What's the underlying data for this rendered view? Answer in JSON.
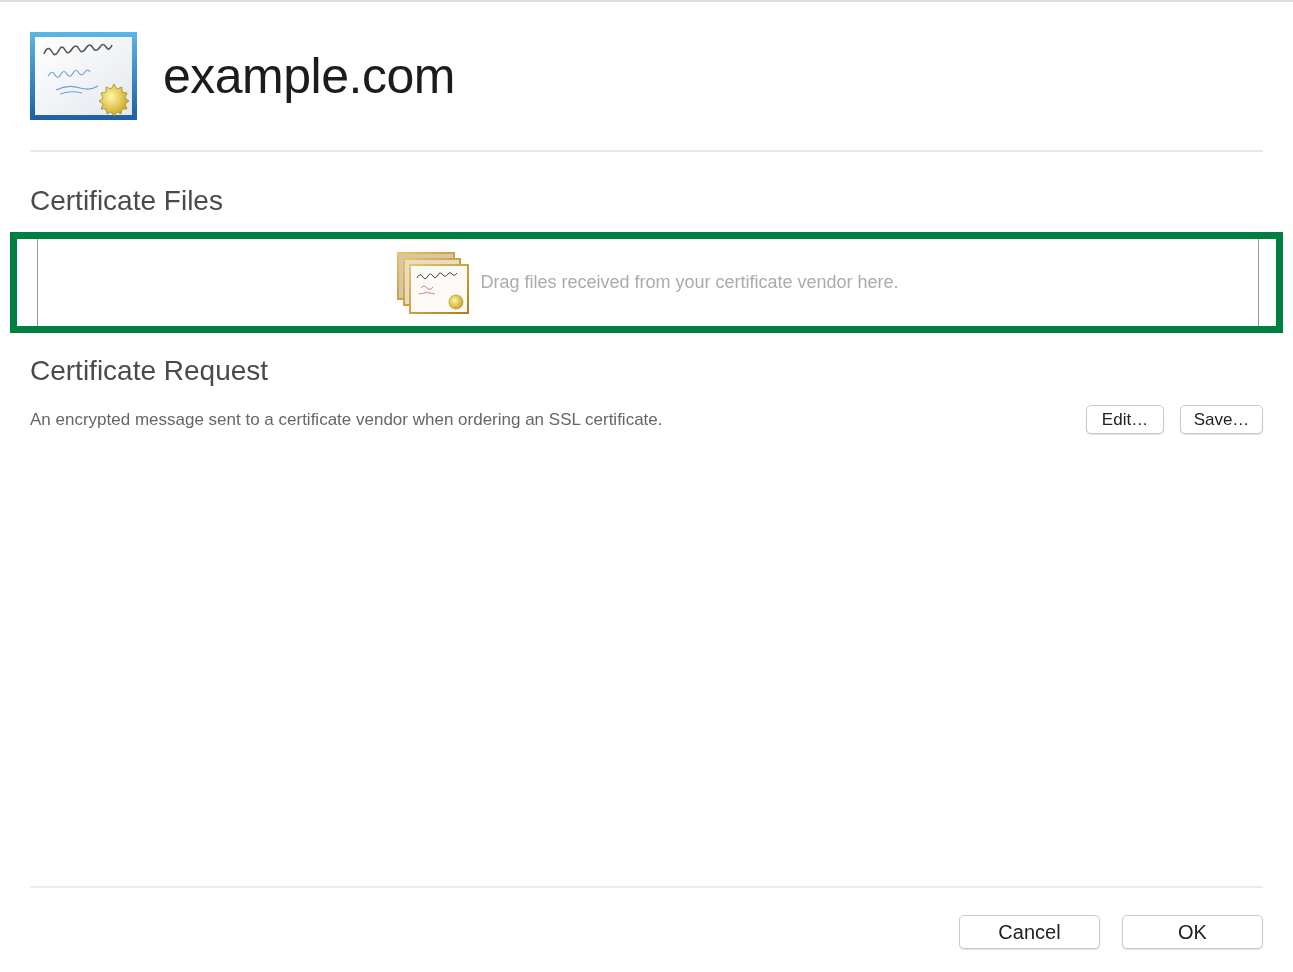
{
  "header": {
    "title": "example.com"
  },
  "certificate_files": {
    "heading": "Certificate Files",
    "drop_zone": {
      "hint": "Drag files received from your certificate vendor here.",
      "highlighted": true
    }
  },
  "certificate_request": {
    "heading": "Certificate Request",
    "description": "An encrypted message sent to a certificate vendor when ordering an SSL certificate.",
    "buttons": [
      {
        "label": "Edit…"
      },
      {
        "label": "Save…"
      }
    ]
  },
  "footer": {
    "buttons": [
      {
        "label": "Cancel"
      },
      {
        "label": "OK"
      }
    ]
  }
}
